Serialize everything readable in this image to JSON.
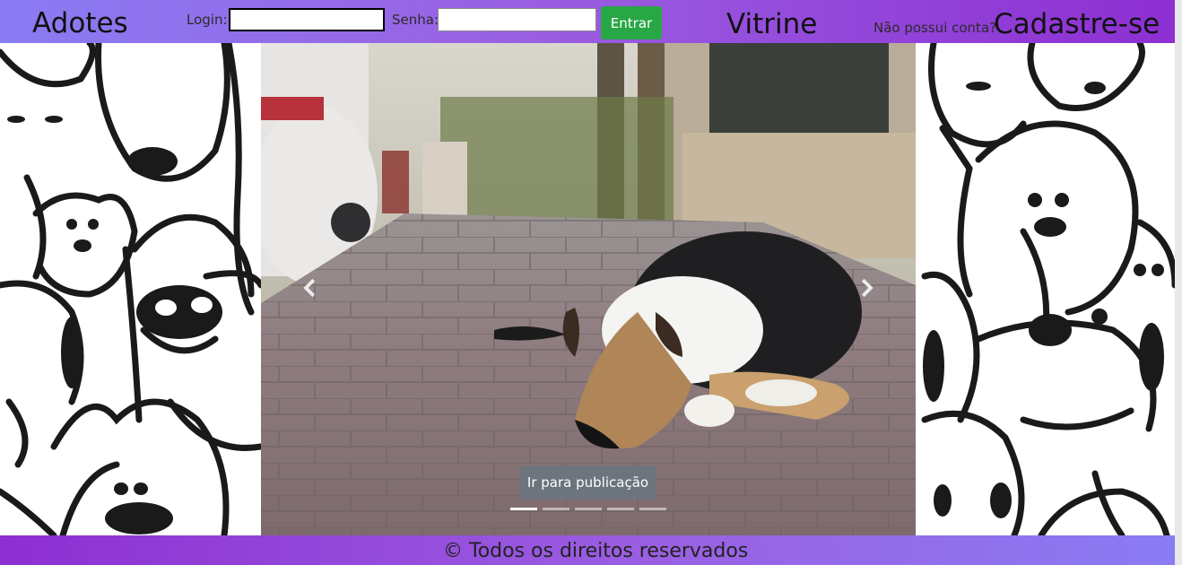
{
  "header": {
    "brand": "Adotes",
    "login_label": "Login:",
    "login_value": "",
    "password_label": "Senha:",
    "password_value": "",
    "enter_button": "Entrar",
    "showcase": "Vitrine",
    "no_account": "Não possui conta?",
    "signup": "Cadastre-se"
  },
  "carousel": {
    "caption_button": "Ir para publicação",
    "slide_count": 5,
    "active_slide": 1,
    "prev_icon": "chevron-left-icon",
    "next_icon": "chevron-right-icon"
  },
  "footer": {
    "text": "© Todos os direitos reservados"
  },
  "colors": {
    "header_start": "#8a7cf3",
    "header_end": "#8d2fd2",
    "enter_button": "#28a745",
    "caption_button": "#6c757d"
  }
}
